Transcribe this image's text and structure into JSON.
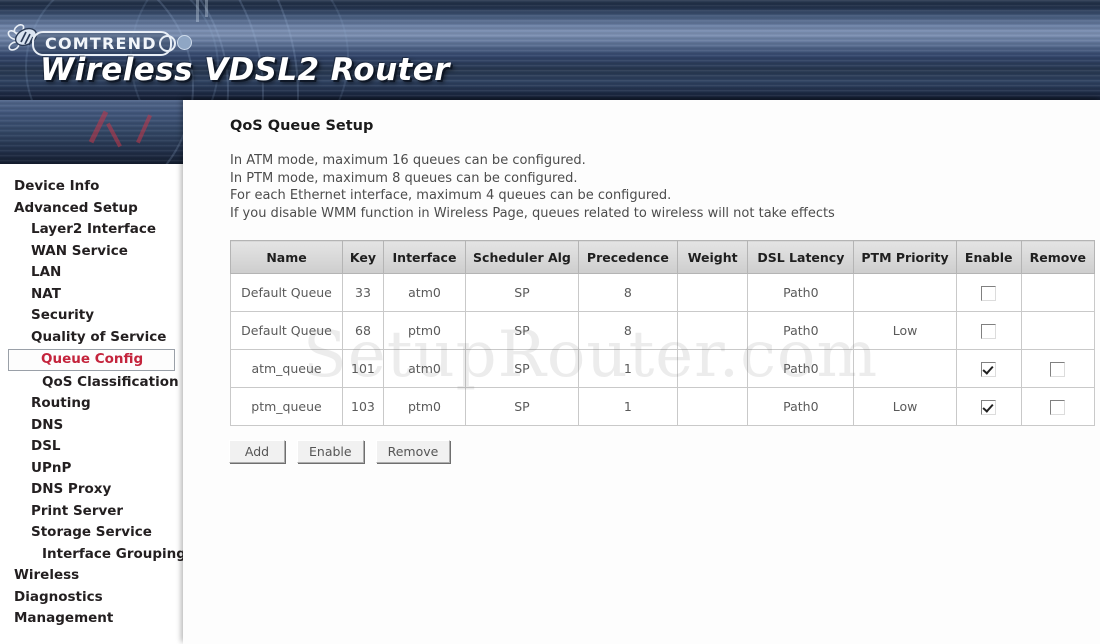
{
  "brand": {
    "logo_text": "COMTREND",
    "product_title": "Wireless VDSL2 Router",
    "emblem_icon": "flower-bee-emblem",
    "accent_color": "#c4243c",
    "banner_color": "#32456a"
  },
  "watermark": {
    "text": "SetupRouter.com"
  },
  "sidebar": {
    "items": [
      {
        "label": "Device Info",
        "level": 0,
        "selected": false
      },
      {
        "label": "Advanced Setup",
        "level": 0,
        "selected": false
      },
      {
        "label": "Layer2 Interface",
        "level": 1,
        "selected": false
      },
      {
        "label": "WAN Service",
        "level": 1,
        "selected": false
      },
      {
        "label": "LAN",
        "level": 1,
        "selected": false
      },
      {
        "label": "NAT",
        "level": 1,
        "selected": false
      },
      {
        "label": "Security",
        "level": 1,
        "selected": false
      },
      {
        "label": "Quality of Service",
        "level": 1,
        "selected": false
      },
      {
        "label": "Queue Config",
        "level": 2,
        "selected": true
      },
      {
        "label": "QoS Classification",
        "level": 2,
        "selected": false
      },
      {
        "label": "Routing",
        "level": 1,
        "selected": false
      },
      {
        "label": "DNS",
        "level": 1,
        "selected": false
      },
      {
        "label": "DSL",
        "level": 1,
        "selected": false
      },
      {
        "label": "UPnP",
        "level": 1,
        "selected": false
      },
      {
        "label": "DNS Proxy",
        "level": 1,
        "selected": false
      },
      {
        "label": "Print Server",
        "level": 1,
        "selected": false
      },
      {
        "label": "Storage Service",
        "level": 1,
        "selected": false
      },
      {
        "label": "Interface Grouping",
        "level": 2,
        "selected": false
      },
      {
        "label": "Wireless",
        "level": 0,
        "selected": false
      },
      {
        "label": "Diagnostics",
        "level": 0,
        "selected": false
      },
      {
        "label": "Management",
        "level": 0,
        "selected": false
      }
    ]
  },
  "main": {
    "title": "QoS Queue Setup",
    "description_lines": [
      "In ATM mode, maximum 16 queues can be configured.",
      "In PTM mode, maximum 8 queues can be configured.",
      "For each Ethernet interface, maximum 4 queues can be configured.",
      "If you disable WMM function in Wireless Page, queues related to wireless will not take effects"
    ],
    "table": {
      "columns": [
        "Name",
        "Key",
        "Interface",
        "Scheduler Alg",
        "Precedence",
        "Weight",
        "DSL Latency",
        "PTM Priority",
        "Enable",
        "Remove"
      ],
      "rows": [
        {
          "name": "Default Queue",
          "key": "33",
          "interface": "atm0",
          "scheduler_alg": "SP",
          "precedence": "8",
          "weight": "",
          "dsl_latency": "Path0",
          "ptm_priority": "",
          "enable_checked": false,
          "enable_present": true,
          "remove_checked": false,
          "remove_present": false
        },
        {
          "name": "Default Queue",
          "key": "68",
          "interface": "ptm0",
          "scheduler_alg": "SP",
          "precedence": "8",
          "weight": "",
          "dsl_latency": "Path0",
          "ptm_priority": "Low",
          "enable_checked": false,
          "enable_present": true,
          "remove_checked": false,
          "remove_present": false
        },
        {
          "name": "atm_queue",
          "key": "101",
          "interface": "atm0",
          "scheduler_alg": "SP",
          "precedence": "1",
          "weight": "",
          "dsl_latency": "Path0",
          "ptm_priority": "",
          "enable_checked": true,
          "enable_present": true,
          "remove_checked": false,
          "remove_present": true
        },
        {
          "name": "ptm_queue",
          "key": "103",
          "interface": "ptm0",
          "scheduler_alg": "SP",
          "precedence": "1",
          "weight": "",
          "dsl_latency": "Path0",
          "ptm_priority": "Low",
          "enable_checked": true,
          "enable_present": true,
          "remove_checked": false,
          "remove_present": true
        }
      ]
    },
    "buttons": [
      {
        "label": "Add"
      },
      {
        "label": "Enable"
      },
      {
        "label": "Remove"
      }
    ]
  }
}
